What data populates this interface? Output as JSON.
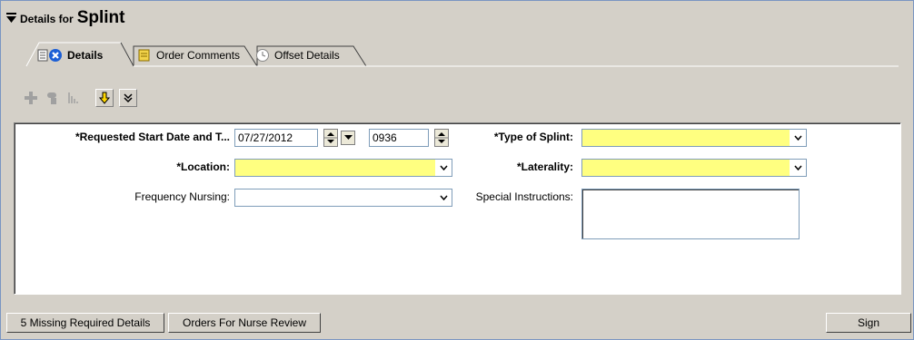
{
  "header": {
    "prefix": "Details for",
    "title": "Splint"
  },
  "tabs": [
    {
      "label": "Details",
      "active": true
    },
    {
      "label": "Order Comments",
      "active": false
    },
    {
      "label": "Offset Details",
      "active": false
    }
  ],
  "form": {
    "start_date": {
      "label": "*Requested Start Date and T...",
      "date": "07/27/2012",
      "time": "0936"
    },
    "location": {
      "label": "*Location:",
      "value": ""
    },
    "frequency": {
      "label": "Frequency Nursing:",
      "value": ""
    },
    "splint_type": {
      "label": "*Type of Splint:",
      "value": ""
    },
    "laterality": {
      "label": "*Laterality:",
      "value": ""
    },
    "special": {
      "label": "Special Instructions:",
      "value": ""
    }
  },
  "status": {
    "missing": "5 Missing Required Details",
    "review": "Orders For Nurse Review",
    "sign": "Sign"
  },
  "colors": {
    "required_bg": "#ffff80",
    "frame_border": "#7a96c2",
    "window_bg": "#d4d0c8"
  }
}
